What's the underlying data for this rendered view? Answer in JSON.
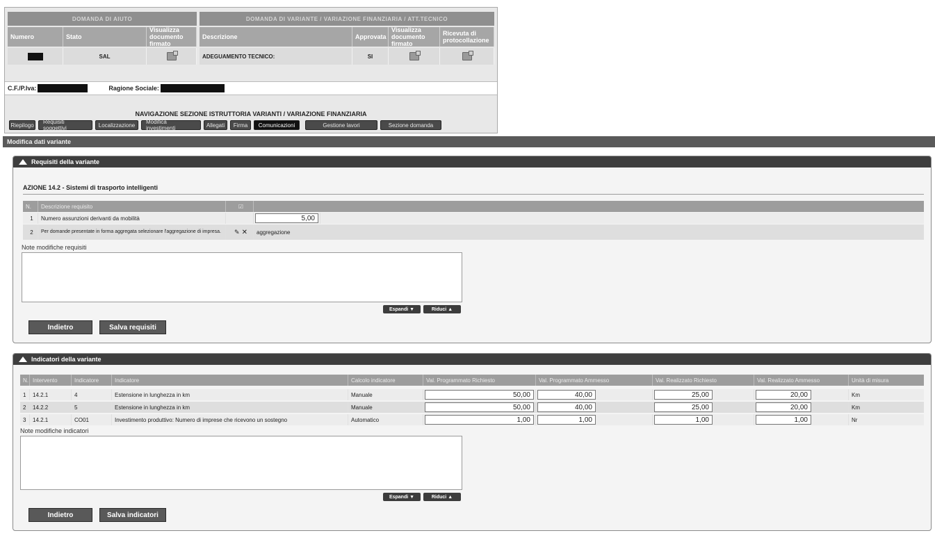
{
  "top": {
    "band_left": "DOMANDA DI AIUTO",
    "band_right": "DOMANDA DI VARIANTE / VARIAZIONE FINANZIARIA / ATT.TECNICO",
    "cols": {
      "numero": "Numero",
      "stato": "Stato",
      "visualizza_left": "Visualizza documento firmato",
      "descrizione": "Descrizione",
      "approvata": "Approvata",
      "visualizza_right": "Visualizza documento firmato",
      "ricevuta": "Ricevuta di protocollazione"
    },
    "row": {
      "stato": "SAL",
      "descrizione": "ADEGUAMENTO TECNICO:",
      "approvata": "SI"
    },
    "cf_label": "C.F./P.Iva:",
    "ragione_label": "Ragione Sociale:"
  },
  "nav": {
    "title": "NAVIGAZIONE SEZIONE ISTRUTTORIA VARIANTI / VARIAZIONE FINANZIARIA",
    "buttons": [
      "Riepilogo",
      "Requisiti soggettivi",
      "Localizzazione",
      "Modifica investimenti",
      "Allegati",
      "Firma",
      "Comunicazioni",
      "Gestione lavori",
      "Sezione domanda"
    ]
  },
  "section_title": "Modifica dati variante",
  "requisiti": {
    "panel_title": "Requisiti della variante",
    "action": "AZIONE 14.2 - Sistemi di trasporto intelligenti",
    "headers": [
      "N.",
      "Descrizione requisito",
      "☑"
    ],
    "rows": [
      {
        "n": "1",
        "desc": "Numero assunzioni derivanti da mobilità",
        "value": "5,00"
      },
      {
        "n": "2",
        "desc": "Per domande presentate in forma aggregata selezionare l'aggregazione di impresa.",
        "extra": "aggregazione"
      }
    ],
    "note_label": "Note modifiche requisiti",
    "espandi": "Espandi ▼",
    "riduci": "Riduci ▲",
    "btn_back": "Indietro",
    "btn_save": "Salva requisiti"
  },
  "indicatori": {
    "panel_title": "Indicatori della variante",
    "headers": [
      "N.",
      "Intervento",
      "Indicatore",
      "Indicatore",
      "Calcolo indicatore",
      "Val. Programmato Richiesto",
      "Val. Programmato Ammesso",
      "Val. Realizzato Richiesto",
      "Val. Realizzato Ammesso",
      "Unità di misura"
    ],
    "rows": [
      {
        "n": "1",
        "intervento": "14.2.1",
        "codice": "4",
        "desc": "Estensione in lunghezza in km",
        "calcolo": "Manuale",
        "v1": "50,00",
        "v2": "40,00",
        "v3": "25,00",
        "v4": "20,00",
        "unit": "Km"
      },
      {
        "n": "2",
        "intervento": "14.2.2",
        "codice": "5",
        "desc": "Estensione in lunghezza in km",
        "calcolo": "Manuale",
        "v1": "50,00",
        "v2": "40,00",
        "v3": "25,00",
        "v4": "20,00",
        "unit": "Km"
      },
      {
        "n": "3",
        "intervento": "14.2.1",
        "codice": "CO01",
        "desc": "Investimento produttivo: Numero di imprese che ricevono un sostegno",
        "calcolo": "Automatico",
        "v1": "1,00",
        "v2": "1,00",
        "v3": "1,00",
        "v4": "1,00",
        "unit": "Nr"
      }
    ],
    "note_label": "Note modifiche indicatori",
    "espandi": "Espandi ▼",
    "riduci": "Riduci ▲",
    "btn_back": "Indietro",
    "btn_save": "Salva indicatori"
  }
}
